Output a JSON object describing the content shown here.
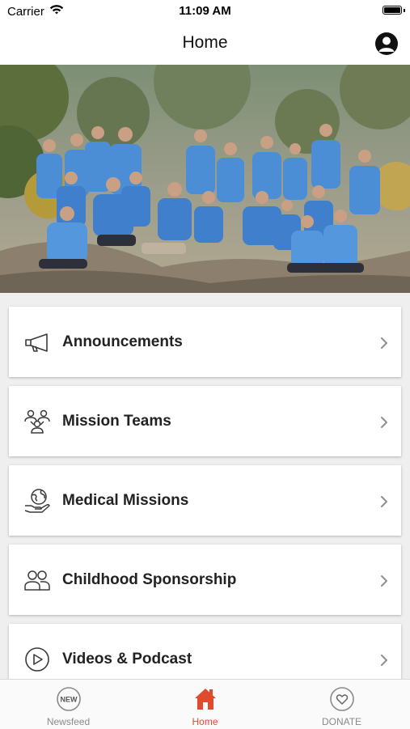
{
  "status_bar": {
    "carrier": "Carrier",
    "time": "11:09 AM"
  },
  "nav": {
    "title": "Home",
    "profile_icon": "user-circle-icon"
  },
  "hero": {
    "description_icon": "group-photo"
  },
  "menu": [
    {
      "label": "Announcements",
      "icon": "megaphone-icon"
    },
    {
      "label": "Mission Teams",
      "icon": "team-icon"
    },
    {
      "label": "Medical Missions",
      "icon": "globe-hand-icon"
    },
    {
      "label": "Childhood Sponsorship",
      "icon": "people-icon"
    },
    {
      "label": "Videos & Podcast",
      "icon": "play-circle-icon"
    }
  ],
  "tabs": [
    {
      "label": "Newsfeed",
      "badge": "NEW",
      "icon": "new-badge-icon",
      "active": false
    },
    {
      "label": "Home",
      "icon": "house-icon",
      "active": true
    },
    {
      "label": "DONATE",
      "icon": "heart-icon",
      "active": false
    }
  ],
  "colors": {
    "accent": "#e04a2d",
    "inactive": "#8a8a8a",
    "background": "#efefef"
  }
}
